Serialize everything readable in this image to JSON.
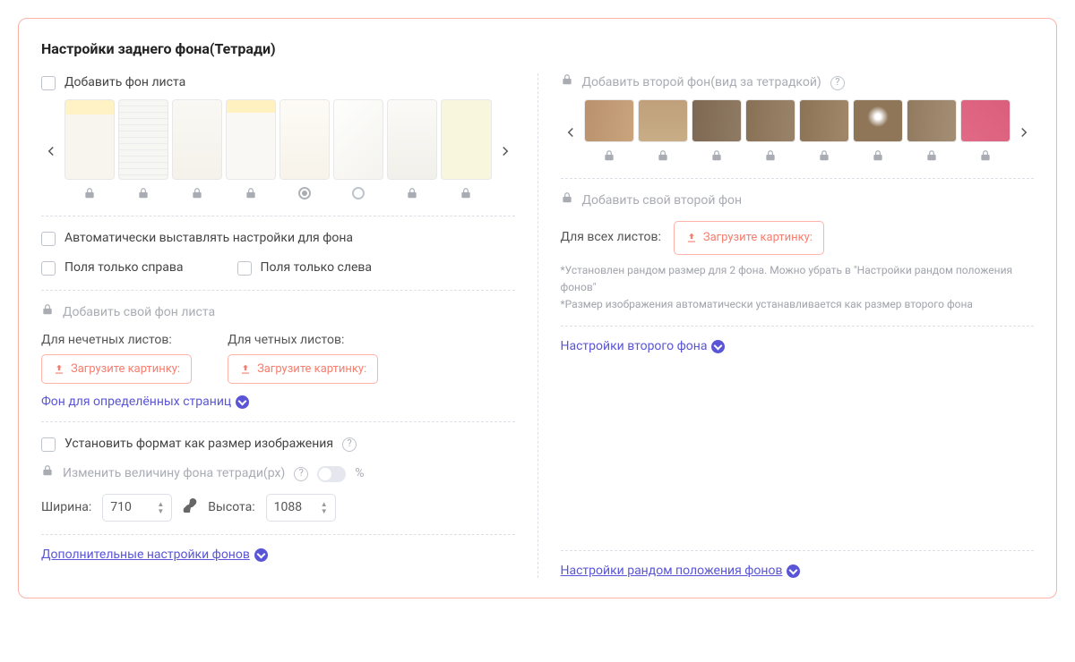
{
  "title": "Настройки заднего фона(Тетради)",
  "left": {
    "add_sheet_bg": "Добавить фон листа",
    "auto_settings": "Автоматически выставлять настройки для фона",
    "margin_right": "Поля только справа",
    "margin_left": "Поля только слева",
    "add_own_sheet_bg": "Добавить свой фон листа",
    "odd_label": "Для нечетных листов:",
    "even_label": "Для четных листов:",
    "upload": "Загрузите картинку:",
    "bg_specific_pages": "Фон для определённых страниц",
    "set_format_as_image": "Установить формат как размер изображения",
    "change_size_px": "Изменить величину фона тетради(px)",
    "percent": "%",
    "width_label": "Ширина:",
    "width_val": "710",
    "height_label": "Высота:",
    "height_val": "1088",
    "more_settings": "Дополнительные настройки фонов"
  },
  "right": {
    "add_second_bg": "Добавить второй фон(вид за тетрадкой)",
    "add_own_second_bg": "Добавить свой второй фон",
    "for_all_sheets": "Для всех листов:",
    "upload": "Загрузите картинку:",
    "note1": "*Установлен рандом размер для 2 фона. Можно убрать в \"Настройки рандом положения фонов\"",
    "note2": "*Размер изображения автоматически устанавливается как размер второго фона",
    "second_bg_settings": "Настройки второго фона",
    "random_pos_settings": "Настройки рандом положения фонов"
  }
}
